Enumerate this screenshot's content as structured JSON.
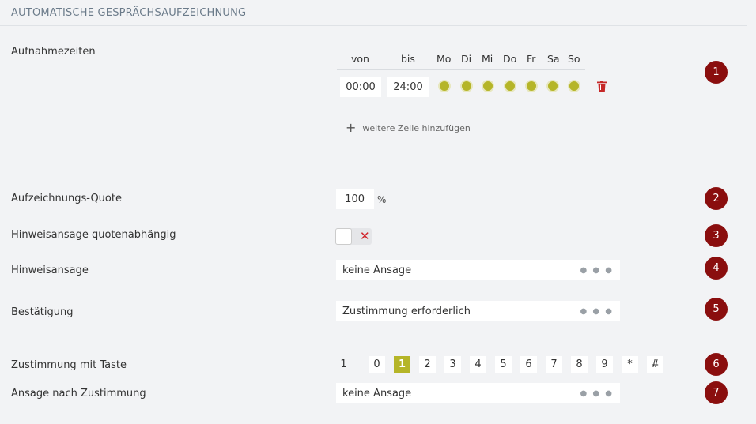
{
  "section_title": "AUTOMATISCHE GESPRÄCHSAUFZEICHNUNG",
  "recording_times": {
    "label": "Aufnahmezeiten",
    "headers": {
      "from": "von",
      "to": "bis"
    },
    "days": [
      "Mo",
      "Di",
      "Mi",
      "Do",
      "Fr",
      "Sa",
      "So"
    ],
    "row": {
      "from": "00:00",
      "to": "24:00"
    },
    "add_row_label": "weitere Zeile hinzufügen"
  },
  "quota": {
    "label": "Aufzeichnungs-Quote",
    "value": "100",
    "unit": "%"
  },
  "quota_dependent_notice": {
    "label": "Hinweisansage quotenabhängig",
    "toggle_symbol": "✕"
  },
  "notice": {
    "label": "Hinweisansage",
    "value": "keine Ansage"
  },
  "confirmation": {
    "label": "Bestätigung",
    "value": "Zustimmung erforderlich"
  },
  "consent_key": {
    "label": "Zustimmung mit Taste",
    "keys": [
      "1",
      "0",
      "1",
      "2",
      "3",
      "4",
      "5",
      "6",
      "7",
      "8",
      "9",
      "*",
      "#"
    ]
  },
  "after_consent": {
    "label": "Ansage nach Zustimmung",
    "value": "keine Ansage"
  },
  "badges": [
    "1",
    "2",
    "3",
    "4",
    "5",
    "6",
    "7"
  ],
  "colors": {
    "accent": "#b5b528",
    "badge": "#8a0e0e",
    "delete": "#d2232a"
  },
  "icons": {
    "delete": "trash-icon",
    "add": "plus-icon",
    "more": "ellipsis-icon"
  }
}
